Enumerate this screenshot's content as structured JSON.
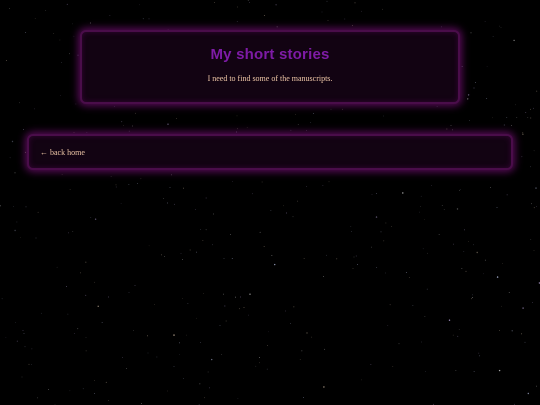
{
  "header": {
    "title": "My short stories",
    "subtitle": "I need to find some of the manuscripts."
  },
  "nav": {
    "back_arrow": "←",
    "back_label": "back home"
  },
  "colors": {
    "background": "#000000",
    "panel_bg": "#120312",
    "panel_glow": "#a014a0",
    "title": "#7e1ba6",
    "text": "#f0c8a8"
  }
}
